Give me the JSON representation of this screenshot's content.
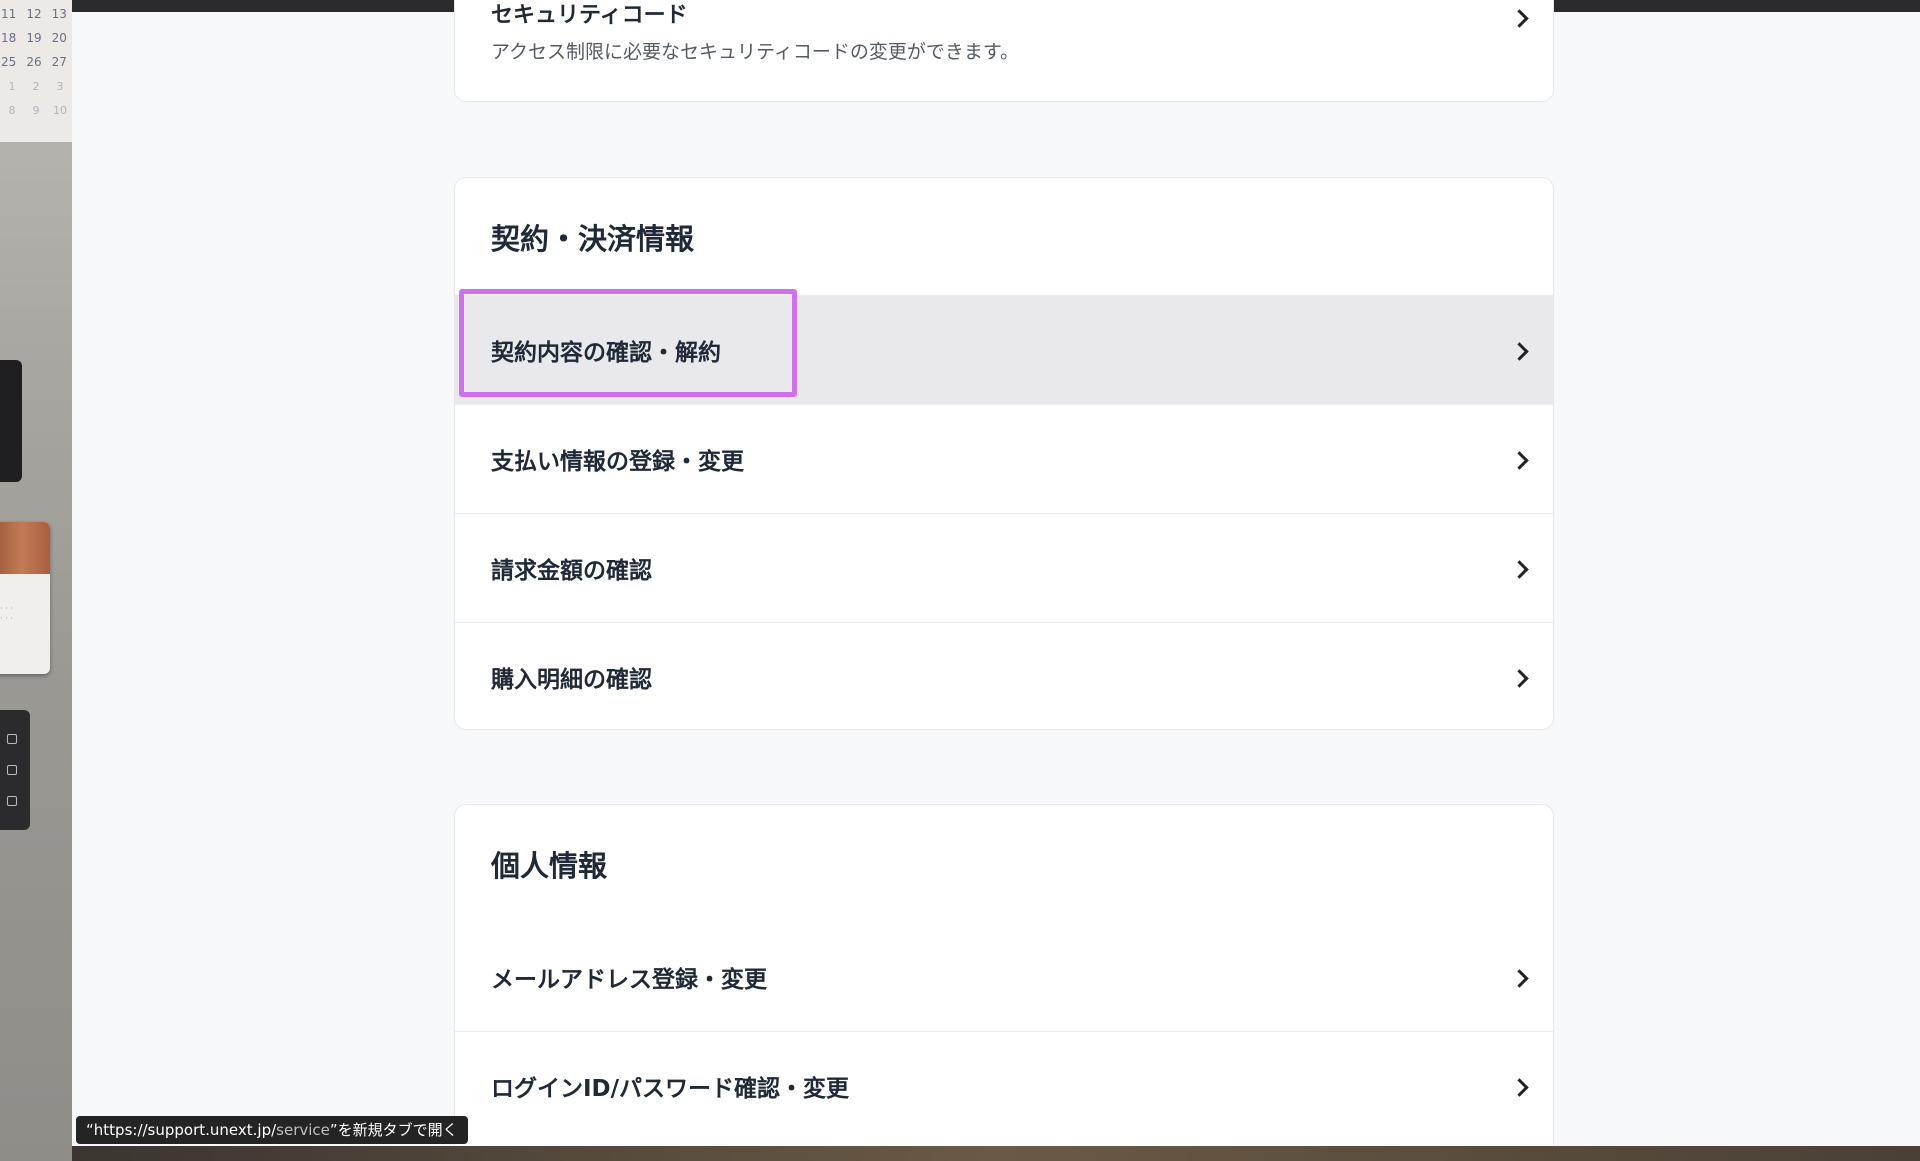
{
  "desktop": {
    "calendar_rows": [
      [
        "11",
        "12",
        "13"
      ],
      [
        "18",
        "19",
        "20"
      ],
      [
        "25",
        "26",
        "27"
      ],
      [
        "1",
        "2",
        "3"
      ],
      [
        "8",
        "9",
        "10"
      ]
    ]
  },
  "security_card": {
    "title": "セキュリティコード",
    "description": "アクセス制限に必要なセキュリティコードの変更ができます。"
  },
  "contract_section": {
    "heading": "契約・決済情報",
    "items": [
      {
        "label": "契約内容の確認・解約",
        "highlighted": true
      },
      {
        "label": "支払い情報の登録・変更"
      },
      {
        "label": "請求金額の確認"
      },
      {
        "label": "購入明細の確認"
      }
    ]
  },
  "personal_section": {
    "heading": "個人情報",
    "items": [
      {
        "label": "メールアドレス登録・変更"
      },
      {
        "label": "ログインID/パスワード確認・変更"
      }
    ]
  },
  "status_bar": {
    "url_host": "https://support.unext.jp/",
    "url_path": "service",
    "suffix": "を新規タブで開く"
  },
  "colors": {
    "highlight": "#cf70ee",
    "active_row": "#e9e9eb",
    "page_bg": "#f7f8f9",
    "text": "#1f2937"
  }
}
